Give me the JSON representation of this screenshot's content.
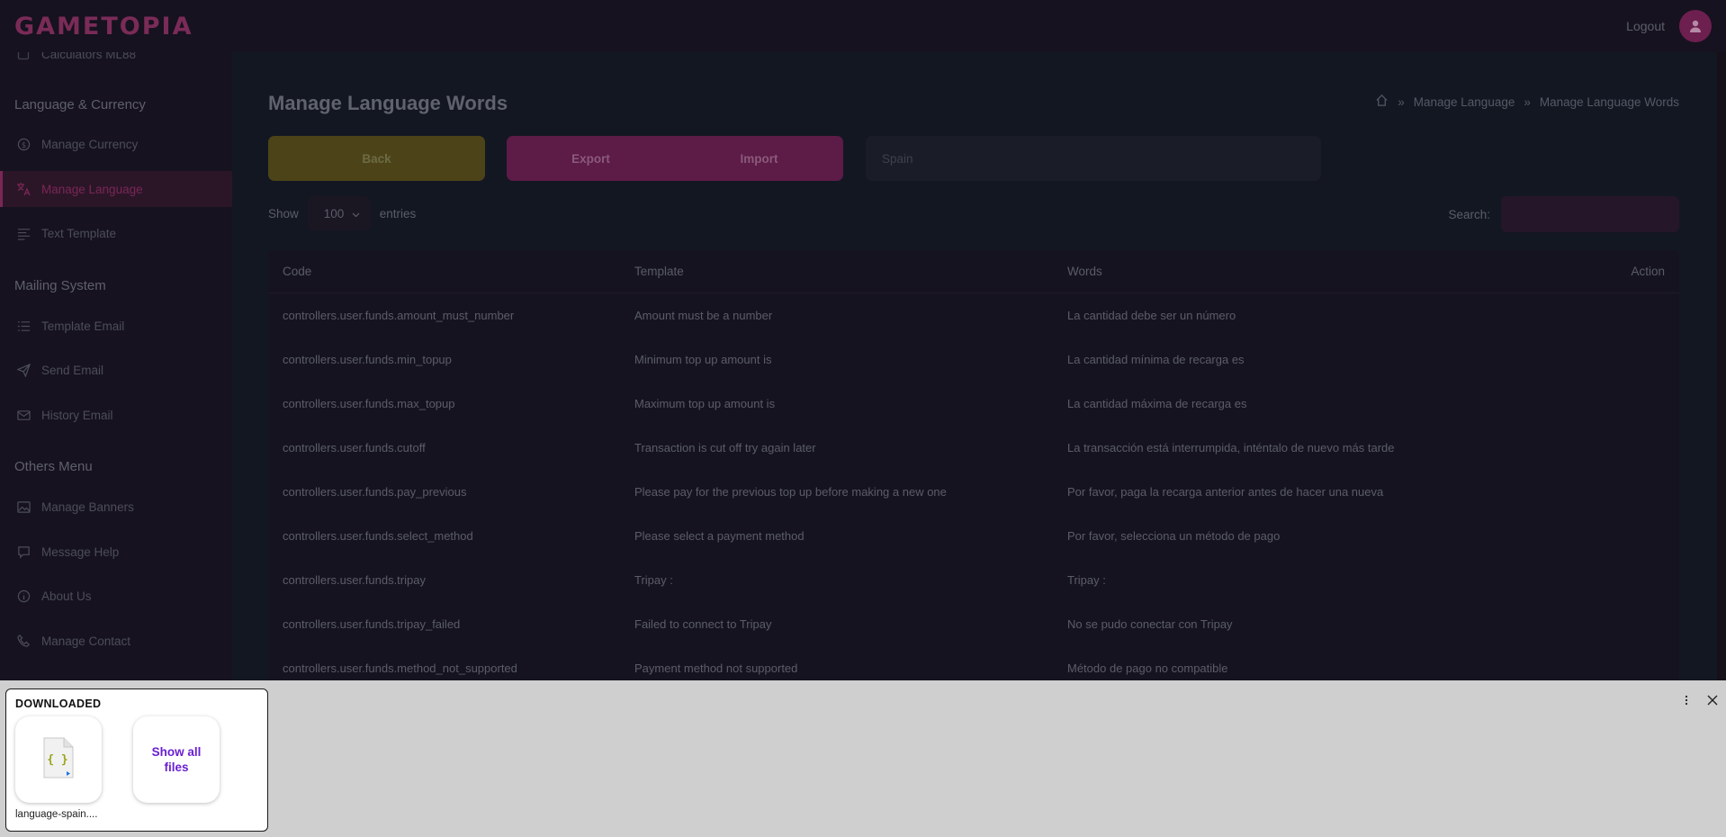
{
  "header": {
    "logo": "GAMETOPIA",
    "logout": "Logout"
  },
  "sidebar": {
    "partial_item": "Calculators ML88",
    "sections": [
      {
        "title": "Language & Currency"
      },
      {
        "title": "Mailing System"
      },
      {
        "title": "Others Menu"
      }
    ],
    "items": [
      {
        "label": "Manage Currency",
        "icon": "currency-icon"
      },
      {
        "label": "Manage Language",
        "icon": "translate-icon",
        "active": true
      },
      {
        "label": "Text Template",
        "icon": "align-left-icon"
      },
      {
        "label": "Template Email",
        "icon": "list-icon"
      },
      {
        "label": "Send Email",
        "icon": "send-icon"
      },
      {
        "label": "History Email",
        "icon": "mail-icon"
      },
      {
        "label": "Manage Banners",
        "icon": "image-icon"
      },
      {
        "label": "Message Help",
        "icon": "message-icon"
      },
      {
        "label": "About Us",
        "icon": "info-icon"
      },
      {
        "label": "Manage Contact",
        "icon": "phone-icon"
      }
    ]
  },
  "page": {
    "title": "Manage Language Words",
    "breadcrumb": [
      "Manage Language",
      "Manage Language Words"
    ],
    "back": "Back",
    "export": "Export",
    "import": "Import",
    "language_placeholder": "Spain",
    "show": "Show",
    "entries_value": "100",
    "entries": "entries",
    "search": "Search:"
  },
  "table": {
    "headers": [
      "Code",
      "Template",
      "Words",
      "Action"
    ],
    "rows": [
      [
        "controllers.user.funds.amount_must_number",
        "Amount must be a number",
        "La cantidad debe ser un número"
      ],
      [
        "controllers.user.funds.min_topup",
        "Minimum top up amount is",
        "La cantidad mínima de recarga es"
      ],
      [
        "controllers.user.funds.max_topup",
        "Maximum top up amount is",
        "La cantidad máxima de recarga es"
      ],
      [
        "controllers.user.funds.cutoff",
        "Transaction is cut off try again later",
        "La transacción está interrumpida, inténtalo de nuevo más tarde"
      ],
      [
        "controllers.user.funds.pay_previous",
        "Please pay for the previous top up before making a new one",
        "Por favor, paga la recarga anterior antes de hacer una nueva"
      ],
      [
        "controllers.user.funds.select_method",
        "Please select a payment method",
        "Por favor, selecciona un método de pago"
      ],
      [
        "controllers.user.funds.tripay",
        "Tripay :",
        "Tripay :"
      ],
      [
        "controllers.user.funds.tripay_failed",
        "Failed to connect to Tripay",
        "No se pudo conectar con Tripay"
      ],
      [
        "controllers.user.funds.method_not_supported",
        "Payment method not supported",
        "Método de pago no compatible"
      ]
    ]
  },
  "downloads": {
    "title": "DOWNLOADED",
    "file_name": "language-spain....",
    "show_all": "Show all files"
  },
  "colors": {
    "accent": "#7a2656",
    "back_button": "#4c4418",
    "export_import": "#5d1b48"
  }
}
